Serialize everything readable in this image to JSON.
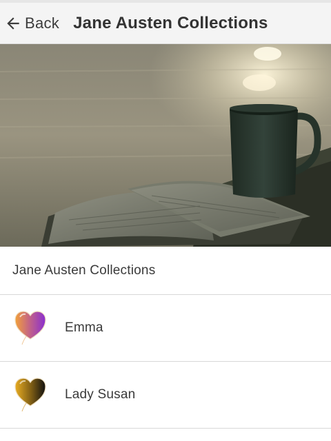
{
  "appbar": {
    "back_label": "Back",
    "title": "Jane Austen Collections"
  },
  "hero": {
    "image": "coffee-mug-and-open-book-photo"
  },
  "section": {
    "title": "Jane Austen Collections"
  },
  "items": [
    {
      "label": "Emma",
      "icon": "heart-balloon-icon",
      "gradient": [
        "#f2a03a",
        "#8a2fd0"
      ]
    },
    {
      "label": "Lady Susan",
      "icon": "heart-balloon-icon",
      "gradient": [
        "#e8ac22",
        "#111111"
      ]
    }
  ],
  "colors": {
    "appbar_bg": "#f4f4f4",
    "divider": "#d8d8d8",
    "text": "#333333"
  }
}
